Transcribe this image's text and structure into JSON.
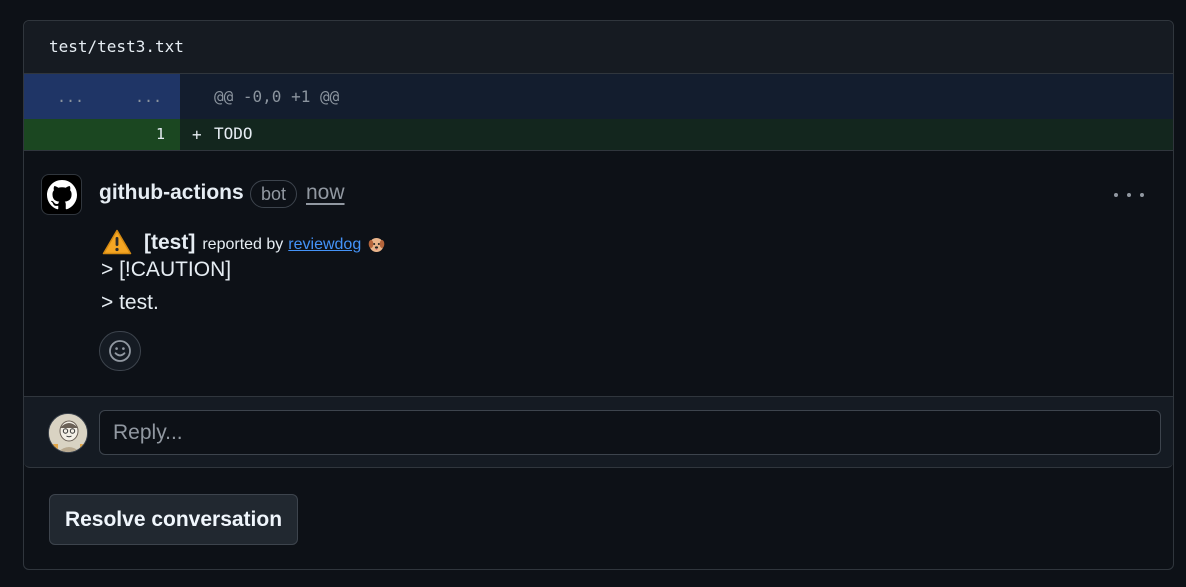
{
  "file": {
    "path": "test/test3.txt"
  },
  "diff": {
    "hunk": {
      "old_num": "...",
      "new_num": "...",
      "header": "@@ -0,0 +1 @@"
    },
    "added_line": {
      "number": "1",
      "sign": "+",
      "code": "TODO"
    }
  },
  "comment": {
    "author": "github-actions",
    "badge": "bot",
    "time": "now",
    "tag": "[test]",
    "reported_by": "reported by",
    "reporter_link": "reviewdog",
    "quote_lines": [
      "> [!CAUTION]",
      "> test."
    ]
  },
  "reply": {
    "placeholder": "Reply..."
  },
  "actions": {
    "resolve_label": "Resolve conversation"
  },
  "colors": {
    "background": "#0d1117",
    "link": "#4493f8",
    "hunk_bg": "#131d2e",
    "add_bg": "#13261e",
    "warning": "#d29922"
  },
  "icons": {
    "author_avatar": "github-mark-icon",
    "warning": "warning-icon",
    "reviewdog": "dog-icon",
    "reaction": "smiley-icon",
    "menu": "kebab-horizontal-icon"
  }
}
